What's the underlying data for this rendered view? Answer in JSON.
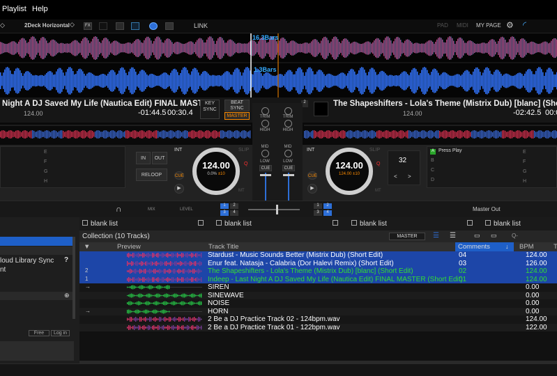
{
  "menu": {
    "playlist": "Playlist",
    "help": "Help"
  },
  "toolbar": {
    "layout": "2Deck Horizontal",
    "fx": "FX",
    "link": "LINK",
    "pad": "PAD",
    "midi": "MIDI",
    "mypage": "MY PAGE"
  },
  "waveform": {
    "deck1_bars": "16.3Bars",
    "deck2_bars": "1.3Bars"
  },
  "deck1": {
    "title": "Night A DJ Saved My Life (Nautica Edit) FINAL MASTE...",
    "bpm": "124.00",
    "remaining": "-01:44.5",
    "elapsed": "00:30.4",
    "key_sync": "KEY SYNC",
    "beat_sync": "BEAT SYNC",
    "master": "MASTER",
    "jog_bpm": "124.00",
    "jog_pitch": "0.0%",
    "jog_range": "±10",
    "hotcue_labels": [
      "E",
      "F",
      "G",
      "H"
    ],
    "in": "IN",
    "out": "OUT",
    "reloop": "RELOOP",
    "cue": "CUE",
    "int": "INT",
    "slip": "SLIP",
    "q": "Q",
    "mt": "MT"
  },
  "deck2": {
    "number": "2",
    "title": "The Shapeshifters - Lola's Theme (Mistrix Dub) [blanc] (Short Ed",
    "bpm": "124.00",
    "remaining": "-02:42.5",
    "elapsed": "00:0",
    "jog_bpm": "124.00",
    "jog_pitch": "124.00",
    "jog_range": "±10",
    "loop_beats": "32",
    "press_play": "Press Play",
    "cue_labels_left": [
      "A",
      "B",
      "C",
      "D"
    ],
    "cue_labels_right": [
      "E",
      "F",
      "G",
      "H"
    ],
    "int": "INT",
    "slip": "SLIP",
    "q": "Q",
    "mt": "MT",
    "cue": "CUE"
  },
  "mixer": {
    "trim": "TRIM",
    "high": "HIGH",
    "mid": "MID",
    "low": "LOW",
    "cue": "CUE",
    "mix": "MIX",
    "level": "LEVEL",
    "master_out": "Master Out",
    "fx_left": [
      "1",
      "2",
      "3",
      "4"
    ],
    "fx_right": [
      "1",
      "2",
      "3",
      "4"
    ]
  },
  "sidebar": {
    "cloud_sync": "loud Library Sync",
    "cloud_sync2": "nt",
    "free": "Free",
    "login": "Log in"
  },
  "list_tabs": [
    "blank list",
    "blank list",
    "blank list",
    "blank list"
  ],
  "collection": {
    "title": "Collection (10 Tracks)",
    "master": "MASTER",
    "search_placeholder": "Q-"
  },
  "columns": {
    "preview": "Preview",
    "title": "Track Title",
    "comments": "Comments",
    "bpm": "BPM",
    "t": "T"
  },
  "tracks": [
    {
      "deck": "",
      "title": "Stardust - Music Sounds Better (Mistrix Dub) (Short Edit)",
      "comment": "04",
      "bpm": "124.00",
      "style": "sel"
    },
    {
      "deck": "",
      "title": "Enur feat. Natasja - Calabria (Dor Halevi Remix) (Short Edit)",
      "comment": "03",
      "bpm": "126.00",
      "style": "sel"
    },
    {
      "deck": "2",
      "title": "The Shapeshifters - Lola's Theme (Mistrix Dub) [blanc] (Short Edit)",
      "comment": "02",
      "bpm": "124.00",
      "style": "green"
    },
    {
      "deck": "1",
      "title": "Indeep - Last Night A DJ Saved My Life (Nautica Edit) FINAL MASTER (Short Edit)",
      "comment": "01",
      "bpm": "124.00",
      "style": "green"
    },
    {
      "deck": "→",
      "title": "SIREN",
      "comment": "",
      "bpm": "0.00",
      "style": "plain"
    },
    {
      "deck": "",
      "title": "SINEWAVE",
      "comment": "",
      "bpm": "0.00",
      "style": "plain"
    },
    {
      "deck": "",
      "title": "NOISE",
      "comment": "",
      "bpm": "0.00",
      "style": "plain"
    },
    {
      "deck": "→",
      "title": "HORN",
      "comment": "",
      "bpm": "0.00",
      "style": "plain"
    },
    {
      "deck": "",
      "title": "2 Be a DJ Practice Track 02 - 124bpm.wav",
      "comment": "",
      "bpm": "124.00",
      "style": "plain"
    },
    {
      "deck": "",
      "title": "2 Be a DJ Practice Track 01 - 122bpm.wav",
      "comment": "",
      "bpm": "122.00",
      "style": "plain"
    }
  ],
  "colors": {
    "accent_blue": "#1e5fc8",
    "green_text": "#33dd33",
    "cue_orange": "#ff8800"
  }
}
